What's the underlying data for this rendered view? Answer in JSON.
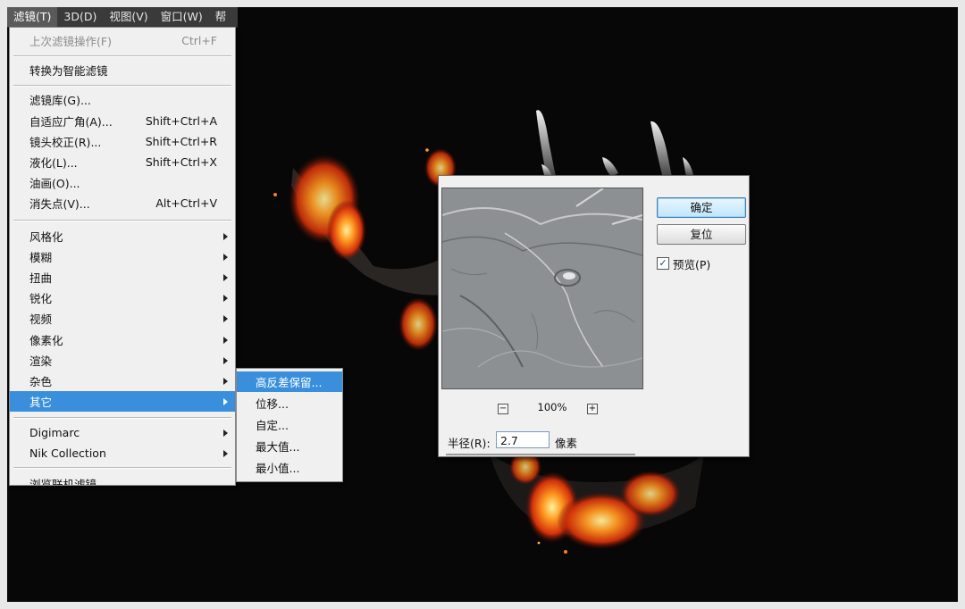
{
  "menubar": {
    "items": [
      "滤镜(T)",
      "3D(D)",
      "视图(V)",
      "窗口(W)",
      "帮"
    ]
  },
  "filter_menu": {
    "last_filter": {
      "label": "上次滤镜操作(F)",
      "shortcut": "Ctrl+F"
    },
    "convert_smart": {
      "label": "转换为智能滤镜"
    },
    "gallery": {
      "label": "滤镜库(G)..."
    },
    "adaptive_wide": {
      "label": "自适应广角(A)...",
      "shortcut": "Shift+Ctrl+A"
    },
    "lens_correction": {
      "label": "镜头校正(R)...",
      "shortcut": "Shift+Ctrl+R"
    },
    "liquify": {
      "label": "液化(L)...",
      "shortcut": "Shift+Ctrl+X"
    },
    "oil_paint": {
      "label": "油画(O)..."
    },
    "vanishing_point": {
      "label": "消失点(V)...",
      "shortcut": "Alt+Ctrl+V"
    },
    "stylize": {
      "label": "风格化"
    },
    "blur": {
      "label": "模糊"
    },
    "distort": {
      "label": "扭曲"
    },
    "sharpen": {
      "label": "锐化"
    },
    "video": {
      "label": "视频"
    },
    "pixelate": {
      "label": "像素化"
    },
    "render": {
      "label": "渲染"
    },
    "noise": {
      "label": "杂色"
    },
    "other": {
      "label": "其它"
    },
    "digimarc": {
      "label": "Digimarc"
    },
    "nik": {
      "label": "Nik Collection"
    },
    "browse_online": {
      "label": "浏览联机滤镜"
    }
  },
  "submenu": {
    "items": [
      "高反差保留...",
      "位移...",
      "自定...",
      "最大值...",
      "最小值..."
    ]
  },
  "dialog": {
    "ok_label": "确定",
    "reset_label": "复位",
    "preview_label": "预览(P)",
    "preview_checked": "✓",
    "zoom_out": "−",
    "zoom_in": "+",
    "zoom_level": "100%",
    "radius_label": "半径(R):",
    "radius_value": "2.7",
    "radius_unit": "像素"
  },
  "colors": {
    "menu_highlight": "#3a8fdc",
    "menu_bg": "#f0f0f0",
    "canvas_bg": "#070707",
    "fire": "#ff6a10"
  }
}
